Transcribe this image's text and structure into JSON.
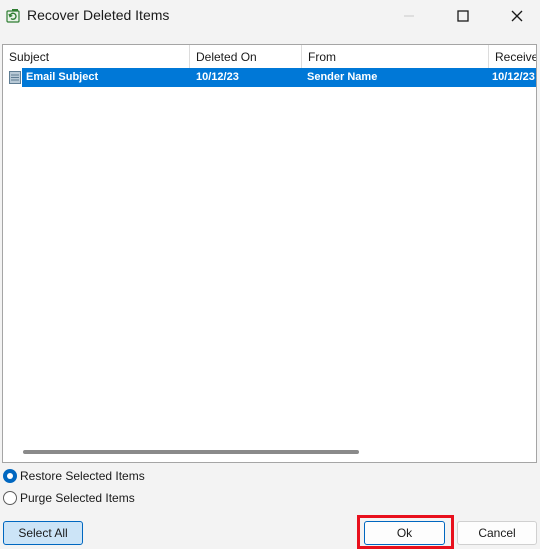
{
  "window": {
    "title": "Recover Deleted Items",
    "icon": "recover-items-icon",
    "controls": [
      "minimize-icon",
      "maximize-icon",
      "close-icon"
    ]
  },
  "grid": {
    "columns": [
      {
        "label": "Subject"
      },
      {
        "label": "Deleted On"
      },
      {
        "label": "From"
      },
      {
        "label": "Receive"
      }
    ],
    "rows": [
      {
        "icon": "email-icon",
        "subject": "Email Subject",
        "deleted_on": "10/12/23",
        "from": "Sender Name",
        "received": "10/12/23",
        "selected": true
      }
    ]
  },
  "options": {
    "restore_label": "Restore Selected Items",
    "purge_label": "Purge Selected Items",
    "selected": "restore"
  },
  "buttons": {
    "select_all": "Select All",
    "ok": "Ok",
    "cancel": "Cancel"
  },
  "colors": {
    "selection": "#0078d7",
    "accent": "#0067c0",
    "highlight": "#e8101c"
  }
}
